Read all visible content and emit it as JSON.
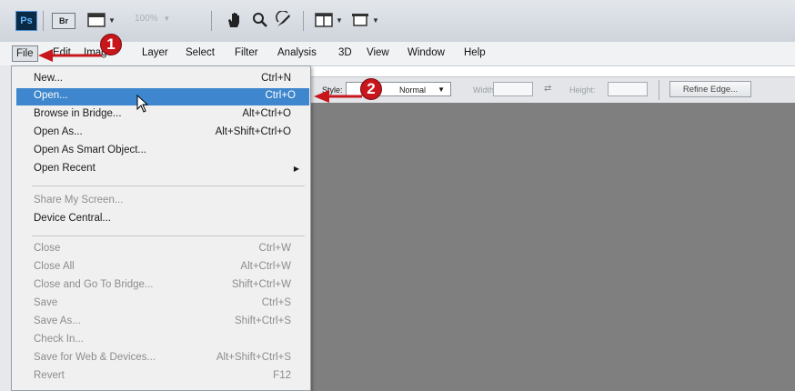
{
  "app": {
    "logo_text": "Ps",
    "bridge_button_text": "Br",
    "zoom_level": "100%"
  },
  "menubar": {
    "items": [
      "File",
      "Edit",
      "Image",
      "Layer",
      "Select",
      "Filter",
      "Analysis",
      "3D",
      "View",
      "Window",
      "Help"
    ]
  },
  "options_bar": {
    "style_label": "Style:",
    "style_value": "Normal",
    "width_label": "Width:",
    "width_value": "",
    "height_label": "Height:",
    "height_value": "",
    "refine_edge_label": "Refine Edge..."
  },
  "file_menu": {
    "items": [
      {
        "label": "New...",
        "shortcut": "Ctrl+N",
        "enabled": true
      },
      {
        "label": "Open...",
        "shortcut": "Ctrl+O",
        "enabled": true,
        "highlighted": true
      },
      {
        "label": "Browse in Bridge...",
        "shortcut": "Alt+Ctrl+O",
        "enabled": true
      },
      {
        "label": "Open As...",
        "shortcut": "Alt+Shift+Ctrl+O",
        "enabled": true
      },
      {
        "label": "Open As Smart Object...",
        "shortcut": "",
        "enabled": true
      },
      {
        "label": "Open Recent",
        "shortcut": "",
        "enabled": true,
        "submenu": true
      },
      {
        "label": "Share My Screen...",
        "shortcut": "",
        "enabled": false
      },
      {
        "label": "Device Central...",
        "shortcut": "",
        "enabled": true
      },
      {
        "label": "Close",
        "shortcut": "Ctrl+W",
        "enabled": false
      },
      {
        "label": "Close All",
        "shortcut": "Alt+Ctrl+W",
        "enabled": false
      },
      {
        "label": "Close and Go To Bridge...",
        "shortcut": "Shift+Ctrl+W",
        "enabled": false
      },
      {
        "label": "Save",
        "shortcut": "Ctrl+S",
        "enabled": false
      },
      {
        "label": "Save As...",
        "shortcut": "Shift+Ctrl+S",
        "enabled": false
      },
      {
        "label": "Check In...",
        "shortcut": "",
        "enabled": false
      },
      {
        "label": "Save for Web & Devices...",
        "shortcut": "Alt+Shift+Ctrl+S",
        "enabled": false
      },
      {
        "label": "Revert",
        "shortcut": "F12",
        "enabled": false
      }
    ]
  },
  "callouts": {
    "step1": "1",
    "step2": "2"
  },
  "colors": {
    "highlight": "#3e86cd",
    "callout": "#c8161d",
    "workspace": "#7f7f7f"
  },
  "icons": [
    "photoshop-logo-icon",
    "bridge-icon",
    "screen-mode-icon",
    "hand-tool-icon",
    "zoom-tool-icon",
    "rotate-view-icon",
    "arrange-documents-icon",
    "workspace-icon",
    "swap-arrows-icon",
    "mouse-pointer-icon",
    "submenu-arrow-icon"
  ]
}
